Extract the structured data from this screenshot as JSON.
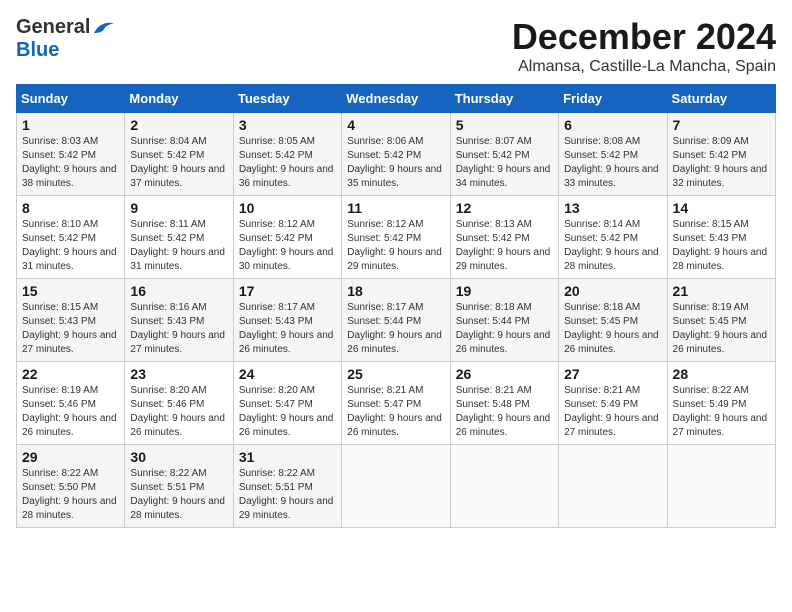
{
  "logo": {
    "part1": "General",
    "part2": "Blue"
  },
  "title": "December 2024",
  "subtitle": "Almansa, Castille-La Mancha, Spain",
  "days_of_week": [
    "Sunday",
    "Monday",
    "Tuesday",
    "Wednesday",
    "Thursday",
    "Friday",
    "Saturday"
  ],
  "weeks": [
    [
      {
        "day": "1",
        "sunrise": "8:03 AM",
        "sunset": "5:42 PM",
        "daylight": "9 hours and 38 minutes."
      },
      {
        "day": "2",
        "sunrise": "8:04 AM",
        "sunset": "5:42 PM",
        "daylight": "9 hours and 37 minutes."
      },
      {
        "day": "3",
        "sunrise": "8:05 AM",
        "sunset": "5:42 PM",
        "daylight": "9 hours and 36 minutes."
      },
      {
        "day": "4",
        "sunrise": "8:06 AM",
        "sunset": "5:42 PM",
        "daylight": "9 hours and 35 minutes."
      },
      {
        "day": "5",
        "sunrise": "8:07 AM",
        "sunset": "5:42 PM",
        "daylight": "9 hours and 34 minutes."
      },
      {
        "day": "6",
        "sunrise": "8:08 AM",
        "sunset": "5:42 PM",
        "daylight": "9 hours and 33 minutes."
      },
      {
        "day": "7",
        "sunrise": "8:09 AM",
        "sunset": "5:42 PM",
        "daylight": "9 hours and 32 minutes."
      }
    ],
    [
      {
        "day": "8",
        "sunrise": "8:10 AM",
        "sunset": "5:42 PM",
        "daylight": "9 hours and 31 minutes."
      },
      {
        "day": "9",
        "sunrise": "8:11 AM",
        "sunset": "5:42 PM",
        "daylight": "9 hours and 31 minutes."
      },
      {
        "day": "10",
        "sunrise": "8:12 AM",
        "sunset": "5:42 PM",
        "daylight": "9 hours and 30 minutes."
      },
      {
        "day": "11",
        "sunrise": "8:12 AM",
        "sunset": "5:42 PM",
        "daylight": "9 hours and 29 minutes."
      },
      {
        "day": "12",
        "sunrise": "8:13 AM",
        "sunset": "5:42 PM",
        "daylight": "9 hours and 29 minutes."
      },
      {
        "day": "13",
        "sunrise": "8:14 AM",
        "sunset": "5:42 PM",
        "daylight": "9 hours and 28 minutes."
      },
      {
        "day": "14",
        "sunrise": "8:15 AM",
        "sunset": "5:43 PM",
        "daylight": "9 hours and 28 minutes."
      }
    ],
    [
      {
        "day": "15",
        "sunrise": "8:15 AM",
        "sunset": "5:43 PM",
        "daylight": "9 hours and 27 minutes."
      },
      {
        "day": "16",
        "sunrise": "8:16 AM",
        "sunset": "5:43 PM",
        "daylight": "9 hours and 27 minutes."
      },
      {
        "day": "17",
        "sunrise": "8:17 AM",
        "sunset": "5:43 PM",
        "daylight": "9 hours and 26 minutes."
      },
      {
        "day": "18",
        "sunrise": "8:17 AM",
        "sunset": "5:44 PM",
        "daylight": "9 hours and 26 minutes."
      },
      {
        "day": "19",
        "sunrise": "8:18 AM",
        "sunset": "5:44 PM",
        "daylight": "9 hours and 26 minutes."
      },
      {
        "day": "20",
        "sunrise": "8:18 AM",
        "sunset": "5:45 PM",
        "daylight": "9 hours and 26 minutes."
      },
      {
        "day": "21",
        "sunrise": "8:19 AM",
        "sunset": "5:45 PM",
        "daylight": "9 hours and 26 minutes."
      }
    ],
    [
      {
        "day": "22",
        "sunrise": "8:19 AM",
        "sunset": "5:46 PM",
        "daylight": "9 hours and 26 minutes."
      },
      {
        "day": "23",
        "sunrise": "8:20 AM",
        "sunset": "5:46 PM",
        "daylight": "9 hours and 26 minutes."
      },
      {
        "day": "24",
        "sunrise": "8:20 AM",
        "sunset": "5:47 PM",
        "daylight": "9 hours and 26 minutes."
      },
      {
        "day": "25",
        "sunrise": "8:21 AM",
        "sunset": "5:47 PM",
        "daylight": "9 hours and 26 minutes."
      },
      {
        "day": "26",
        "sunrise": "8:21 AM",
        "sunset": "5:48 PM",
        "daylight": "9 hours and 26 minutes."
      },
      {
        "day": "27",
        "sunrise": "8:21 AM",
        "sunset": "5:49 PM",
        "daylight": "9 hours and 27 minutes."
      },
      {
        "day": "28",
        "sunrise": "8:22 AM",
        "sunset": "5:49 PM",
        "daylight": "9 hours and 27 minutes."
      }
    ],
    [
      {
        "day": "29",
        "sunrise": "8:22 AM",
        "sunset": "5:50 PM",
        "daylight": "9 hours and 28 minutes."
      },
      {
        "day": "30",
        "sunrise": "8:22 AM",
        "sunset": "5:51 PM",
        "daylight": "9 hours and 28 minutes."
      },
      {
        "day": "31",
        "sunrise": "8:22 AM",
        "sunset": "5:51 PM",
        "daylight": "9 hours and 29 minutes."
      },
      null,
      null,
      null,
      null
    ]
  ]
}
